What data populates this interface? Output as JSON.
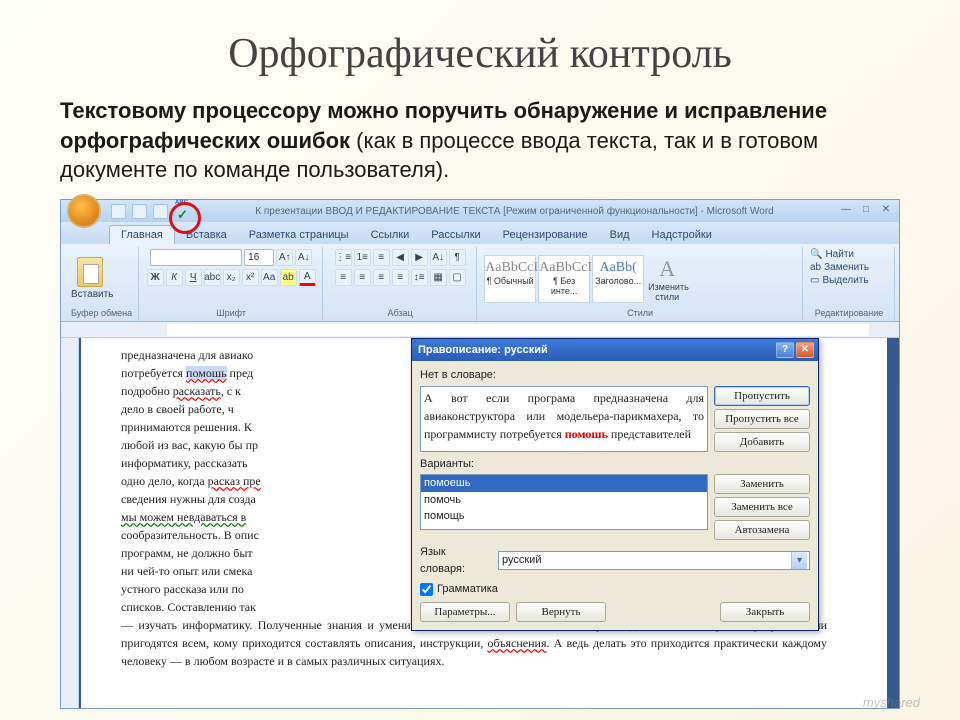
{
  "slide": {
    "title": "Орфографический контроль",
    "text_prefix": "Текстовому процессору можно поручить обнаружение и исправление орфографических ошибок",
    "text_suffix": " (как в процессе ввода текста, так и в готовом документе по команде пользователя)."
  },
  "word": {
    "title": "К презентации ВВОД И РЕДАКТИРОВАНИЕ ТЕКСТА [Режим ограниченной функциональности] - Microsoft Word",
    "tabs": [
      "Главная",
      "Вставка",
      "Разметка страницы",
      "Ссылки",
      "Рассылки",
      "Рецензирование",
      "Вид",
      "Надстройки"
    ],
    "active_tab": "Главная",
    "paste": "Вставить",
    "groups": {
      "clipboard": "Буфер обмена",
      "font": "Шрифт",
      "paragraph": "Абзац",
      "styles": "Стили",
      "editing": "Редактирование"
    },
    "font_size": "16",
    "bold": "Ж",
    "italic": "К",
    "underline": "Ч",
    "style_items": [
      {
        "preview": "AaBbCcI",
        "name": "¶ Обычный"
      },
      {
        "preview": "AaBbCcI",
        "name": "¶ Без инте..."
      },
      {
        "preview": "AaBb(",
        "name": "Заголово..."
      }
    ],
    "change_styles": "Изменить стили",
    "editing": {
      "find": "Найти",
      "replace": "Заменить",
      "select": "Выделить"
    }
  },
  "doc": {
    "lines": [
      "предназначена для авиако",
      "потребуется ",
      "помошь",
      " пред",
      "подробно ",
      "расказать",
      ", с к",
      "дело в своей работе, ч",
      "принимаются решения. К",
      "любой из вас, какую бы пр",
      "информатику, рассказать",
      "одно дело, когда ",
      "расказ пре",
      "сведения нужны для созда",
      "мы можем невдаваться в",
      "сообразительность. В опис",
      "программ, не должно быт",
      "ни чей-то опыт или смека",
      "устного рассказа или по",
      "списков. Составлению так",
      "— изучать информатику. Полученные знания и умения можно использовать не только при создании компьютерных программ. Они пригодятся всем, кому приходится составлять описания, инструкции, ",
      "объяснения",
      ". А ведь делать это приходится практически каждому человеку — в любом возрасте и в самых различных ситуациях."
    ]
  },
  "dialog": {
    "title": "Правописание: русский",
    "lbl_not_in_dict": "Нет в словаре:",
    "context_pre": "А вот если програма предназначена для авиаконструктора или модельера-парикмахера, то программисту потребуется ",
    "context_err": "помошь",
    "context_post": " представителей",
    "lbl_variants": "Варианты:",
    "variants": [
      "помоешь",
      "помочь",
      "помощь"
    ],
    "lbl_lang": "Язык словаря:",
    "lang": "русский",
    "chk_grammar": "Грамматика",
    "btn_ignore": "Пропустить",
    "btn_ignore_all": "Пропустить все",
    "btn_add": "Добавить",
    "btn_change": "Заменить",
    "btn_change_all": "Заменить все",
    "btn_autocorrect": "Автозамена",
    "btn_options": "Параметры...",
    "btn_undo": "Вернуть",
    "btn_close": "Закрыть"
  },
  "watermark": "myshared"
}
